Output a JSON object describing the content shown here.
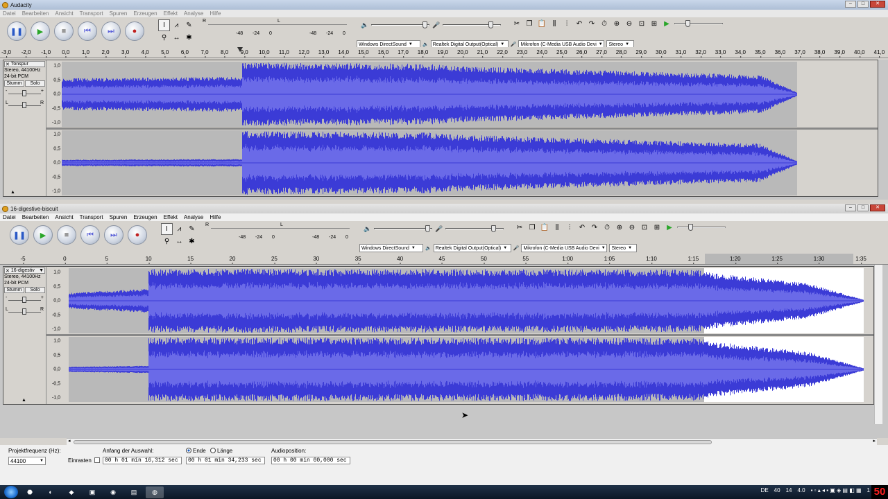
{
  "colors": {
    "waveform": "#3b3bd6",
    "waveform_light": "#6a6ae8",
    "track_bg": "#b9b9b9",
    "selection_bg": "#ffffff",
    "accent_clock": "#ff2020"
  },
  "window1": {
    "title": "Audacity",
    "menu": [
      "Datei",
      "Bearbeiten",
      "Ansicht",
      "Transport",
      "Spuren",
      "Erzeugen",
      "Effekt",
      "Analyse",
      "Hilfe"
    ],
    "meters": {
      "left_label": "L",
      "right_label": "R",
      "scale": [
        "-48",
        "-24",
        "0",
        "-48",
        "-24",
        "0"
      ]
    },
    "devices": {
      "host": "Windows DirectSound",
      "output": "Realtek Digital Output(Optical)",
      "input": "Mikrofon (C-Media USB Audio Devi",
      "channels": "Stereo"
    },
    "ruler": [
      "-3,0",
      "-2,0",
      "-1,0",
      "0,0",
      "1,0",
      "2,0",
      "3,0",
      "4,0",
      "5,0",
      "6,0",
      "7,0",
      "8,0",
      "9,0",
      "10,0",
      "11,0",
      "12,0",
      "13,0",
      "14,0",
      "15,0",
      "16,0",
      "17,0",
      "18,0",
      "19,0",
      "20,0",
      "21,0",
      "22,0",
      "23,0",
      "24,0",
      "25,0",
      "26,0",
      "27,0",
      "28,0",
      "29,0",
      "30,0",
      "31,0",
      "32,0",
      "33,0",
      "34,0",
      "35,0",
      "36,0",
      "37,0",
      "38,0",
      "39,0",
      "40,0",
      "41,0"
    ],
    "track": {
      "name": "Tonspur",
      "format_line1": "Stereo, 44100Hz",
      "format_line2": "24-bit PCM",
      "mute": "Stumm",
      "solo": "Solo",
      "gain_min": "-",
      "gain_max": "+",
      "pan_left": "L",
      "pan_right": "R",
      "scale": [
        "1,0",
        "0,5",
        "0,0",
        "-0,5",
        "-1,0"
      ]
    }
  },
  "window2": {
    "title": "16-digestive-biscuit",
    "menu": [
      "Datei",
      "Bearbeiten",
      "Ansicht",
      "Transport",
      "Spuren",
      "Erzeugen",
      "Effekt",
      "Analyse",
      "Hilfe"
    ],
    "meters": {
      "left_label": "L",
      "right_label": "R",
      "scale": [
        "-48",
        "-24",
        "0",
        "-48",
        "-24",
        "0"
      ]
    },
    "devices": {
      "host": "Windows DirectSound",
      "output": "Realtek Digital Output(Optical)",
      "input": "Mikrofon (C-Media USB Audio Devi",
      "channels": "Stereo"
    },
    "ruler": [
      "-5",
      "0",
      "5",
      "10",
      "15",
      "20",
      "25",
      "30",
      "35",
      "40",
      "45",
      "50",
      "55",
      "1:00",
      "1:05",
      "1:10",
      "1:15",
      "1:20",
      "1:25",
      "1:30",
      "1:35"
    ],
    "track": {
      "name": "16-digestiv",
      "format_line1": "Stereo, 44100Hz",
      "format_line2": "24-bit PCM",
      "mute": "Stumm",
      "solo": "Solo",
      "gain_min": "-",
      "gain_max": "+",
      "pan_left": "L",
      "pan_right": "R",
      "scale": [
        "1,0",
        "0,5",
        "0,0",
        "-0,5",
        "-1,0"
      ]
    },
    "status": {
      "rate_label": "Projektfrequenz (Hz):",
      "rate_value": "44100",
      "selection_label": "Anfang der Auswahl:",
      "snap_label": "Einrasten",
      "end_label": "Ende",
      "length_label": "Länge",
      "selection_start": "00 h 01 min 16,312 sec",
      "selection_end": "00 h 01 min 34,233 sec",
      "position_label": "Audioposition:",
      "position_value": "00 h 00 min 00,000 sec"
    }
  },
  "taskbar": {
    "lang": "DE",
    "tray_nums": [
      "40",
      "14",
      "4.0"
    ],
    "day": "1",
    "clock_digits": "50"
  }
}
